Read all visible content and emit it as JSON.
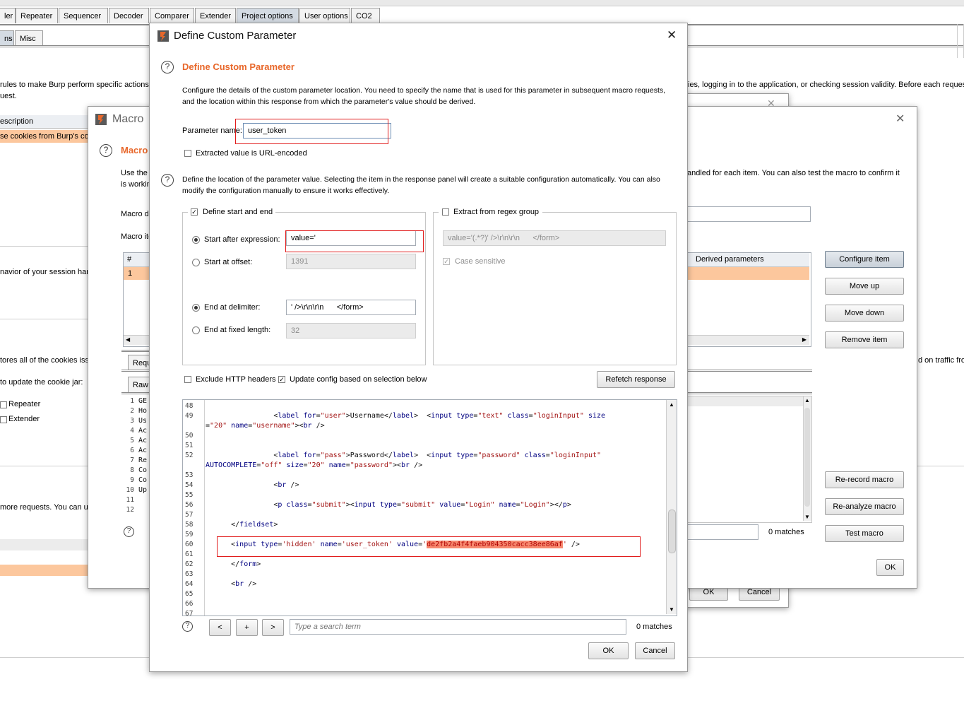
{
  "app": {
    "tabs": [
      "ler",
      "Repeater",
      "Sequencer",
      "Decoder",
      "Comparer",
      "Extender",
      "Project options",
      "User options",
      "CO2"
    ],
    "active_tab": "Project options",
    "subtabs": [
      "ns",
      "Misc"
    ],
    "background": {
      "intro_line1": "rules to make Burp perform specific actions",
      "intro_line1_right": "ies, logging in to the application, or checking session validity. Before each reques",
      "intro_line2": "uest.",
      "table_header_description": "escription",
      "table_row1": "se cookies from Burp's co",
      "behavior_text": "navior of your session han",
      "stores_text": "tores all of the cookies iss",
      "traffic_text": "d on traffic fro",
      "update_text": "to update the cookie jar:",
      "repeater_label": "Repeater",
      "extender_label": "Extender",
      "more_requests_text": "more requests. You can u"
    }
  },
  "macro_window": {
    "title": "Macro",
    "heading": "Macro",
    "use_the": "Use the",
    "is_workin": "is workin",
    "macro_desc_label": "Macro de",
    "macro_items_label": "Macro ite",
    "right_text": "andled for each item. You can also test the macro to confirm it",
    "table_col_num": "#",
    "table_col_derived": "Derived parameters",
    "table_row_num": "1",
    "buttons": {
      "configure_item": "Configure item",
      "move_up": "Move up",
      "move_down": "Move down",
      "remove_item": "Remove item",
      "re_record": "Re-record macro",
      "re_analyze": "Re-analyze macro",
      "test_macro": "Test macro",
      "ok": "OK",
      "back_ok": "OK",
      "back_cancel": "Cancel"
    },
    "tab_request": "Requ",
    "tab_raw": "Raw",
    "req_lines": [
      "GE",
      "Ho",
      "Us",
      "Ac",
      "Ac",
      "Ac",
      "Re",
      "Co",
      "Co",
      "Up",
      "",
      ""
    ],
    "req_line_numbers": [
      "1",
      "2",
      "3",
      "4",
      "5",
      "6",
      "7",
      "8",
      "9",
      "10",
      "11",
      "12"
    ],
    "matches": "0 matches"
  },
  "dialog": {
    "title": "Define Custom Parameter",
    "heading": "Define Custom Parameter",
    "description": "Configure the details of the custom parameter location. You need to specify the name that is used for this parameter in subsequent macro requests, and the location within this response from which the parameter's value should be derived.",
    "param_name_label": "Parameter name:",
    "param_name_value": "user_token",
    "url_encoded_label": "Extracted value is URL-encoded",
    "location_description": "Define the location of the parameter value. Selecting the item in the response panel will create a suitable configuration automatically. You can also modify the configuration manually to ensure it works effectively.",
    "define_start_end_label": "Define start and end",
    "start_after_label": "Start after expression:",
    "start_after_value": "value='",
    "start_offset_label": "Start at offset:",
    "start_offset_value": "1391",
    "end_delimiter_label": "End at delimiter:",
    "end_delimiter_value": "' />\\r\\n\\r\\n      </form>",
    "end_fixed_label": "End at fixed length:",
    "end_fixed_value": "32",
    "regex_label": "Extract from regex group",
    "regex_value": "value='(.*?)' />\\r\\n\\r\\n      </form>",
    "case_sensitive_label": "Case sensitive",
    "exclude_headers_label": "Exclude HTTP headers",
    "update_config_label": "Update config based on selection below",
    "refetch_button": "Refetch response",
    "search_placeholder": "Type a search term",
    "matches": "0 matches",
    "nav_prev": "<",
    "nav_add": "+",
    "nav_next": ">",
    "ok_button": "OK",
    "cancel_button": "Cancel",
    "token_value": "de2fb2a4f4faeb904350cacc38ee86af",
    "code_lines": [
      {
        "n": "48",
        "parts": []
      },
      {
        "n": "49",
        "parts": [
          [
            "",
            "                <"
          ],
          [
            "t",
            "label"
          ],
          [
            "a",
            " for"
          ],
          [
            "",
            "="
          ],
          [
            "v",
            "\"user\""
          ],
          [
            "",
            ">Username</"
          ],
          [
            "t",
            "label"
          ],
          [
            "",
            ">  <"
          ],
          [
            "t",
            "input"
          ],
          [
            "a",
            " type"
          ],
          [
            "",
            "="
          ],
          [
            "v",
            "\"text\""
          ],
          [
            "a",
            " class"
          ],
          [
            "",
            "="
          ],
          [
            "v",
            "\"loginInput\""
          ],
          [
            "a",
            " size"
          ]
        ]
      },
      {
        "n": "",
        "parts": [
          [
            "",
            "="
          ],
          [
            "v",
            "\"20\""
          ],
          [
            "a",
            " name"
          ],
          [
            "",
            "="
          ],
          [
            "v",
            "\"username\""
          ],
          [
            "",
            "><"
          ],
          [
            "t",
            "br"
          ],
          [
            "",
            " />"
          ]
        ],
        "wrap": true
      },
      {
        "n": "50",
        "parts": []
      },
      {
        "n": "51",
        "parts": []
      },
      {
        "n": "52",
        "parts": [
          [
            "",
            "                <"
          ],
          [
            "t",
            "label"
          ],
          [
            "a",
            " for"
          ],
          [
            "",
            "="
          ],
          [
            "v",
            "\"pass\""
          ],
          [
            "",
            ">Password</"
          ],
          [
            "t",
            "label"
          ],
          [
            "",
            ">  <"
          ],
          [
            "t",
            "input"
          ],
          [
            "a",
            " type"
          ],
          [
            "",
            "="
          ],
          [
            "v",
            "\"password\""
          ],
          [
            "a",
            " class"
          ],
          [
            "",
            "="
          ],
          [
            "v",
            "\"loginInput\""
          ]
        ]
      },
      {
        "n": "",
        "parts": [
          [
            "a",
            "AUTOCOMPLETE"
          ],
          [
            "",
            "="
          ],
          [
            "v",
            "\"off\""
          ],
          [
            "a",
            " size"
          ],
          [
            "",
            "="
          ],
          [
            "v",
            "\"20\""
          ],
          [
            "a",
            " name"
          ],
          [
            "",
            "="
          ],
          [
            "v",
            "\"password\""
          ],
          [
            "",
            "><"
          ],
          [
            "t",
            "br"
          ],
          [
            "",
            " />"
          ]
        ],
        "wrap": true
      },
      {
        "n": "53",
        "parts": []
      },
      {
        "n": "54",
        "parts": [
          [
            "",
            "                <"
          ],
          [
            "t",
            "br"
          ],
          [
            "",
            " />"
          ]
        ]
      },
      {
        "n": "55",
        "parts": []
      },
      {
        "n": "56",
        "parts": [
          [
            "",
            "                <"
          ],
          [
            "t",
            "p"
          ],
          [
            "a",
            " class"
          ],
          [
            "",
            "="
          ],
          [
            "v",
            "\"submit\""
          ],
          [
            "",
            "><"
          ],
          [
            "t",
            "input"
          ],
          [
            "a",
            " type"
          ],
          [
            "",
            "="
          ],
          [
            "v",
            "\"submit\""
          ],
          [
            "a",
            " value"
          ],
          [
            "",
            "="
          ],
          [
            "v",
            "\"Login\""
          ],
          [
            "a",
            " name"
          ],
          [
            "",
            "="
          ],
          [
            "v",
            "\"Login\""
          ],
          [
            "",
            "></"
          ],
          [
            "t",
            "p"
          ],
          [
            "",
            ">"
          ]
        ]
      },
      {
        "n": "57",
        "parts": []
      },
      {
        "n": "58",
        "parts": [
          [
            "",
            "      </"
          ],
          [
            "t",
            "fieldset"
          ],
          [
            "",
            ">"
          ]
        ]
      },
      {
        "n": "59",
        "parts": []
      },
      {
        "n": "60",
        "parts": [
          [
            "",
            "      <"
          ],
          [
            "t",
            "input"
          ],
          [
            "a",
            " type"
          ],
          [
            "",
            "="
          ],
          [
            "v",
            "'hidden'"
          ],
          [
            "a",
            " name"
          ],
          [
            "",
            "="
          ],
          [
            "v",
            "'user_token'"
          ],
          [
            "a",
            " value"
          ],
          [
            "",
            "="
          ],
          [
            "v",
            "'"
          ],
          [
            "h",
            "de2fb2a4f4faeb904350cacc38ee86af"
          ],
          [
            "v",
            "'"
          ],
          [
            "",
            " />"
          ]
        ]
      },
      {
        "n": "61",
        "parts": []
      },
      {
        "n": "62",
        "parts": [
          [
            "",
            "      </"
          ],
          [
            "t",
            "form"
          ],
          [
            "",
            ">"
          ]
        ]
      },
      {
        "n": "63",
        "parts": []
      },
      {
        "n": "64",
        "parts": [
          [
            "",
            "      <"
          ],
          [
            "t",
            "br"
          ],
          [
            "",
            " />"
          ]
        ]
      },
      {
        "n": "65",
        "parts": []
      },
      {
        "n": "66",
        "parts": []
      },
      {
        "n": "67",
        "parts": []
      }
    ]
  },
  "colors": {
    "accent_orange": "#e8672a",
    "highlight_red": "#e11d1d",
    "selected_row": "#fcc79d"
  },
  "icons": {
    "burp_logo": "burp-logo-icon",
    "close": "close-icon",
    "help": "help-icon"
  }
}
